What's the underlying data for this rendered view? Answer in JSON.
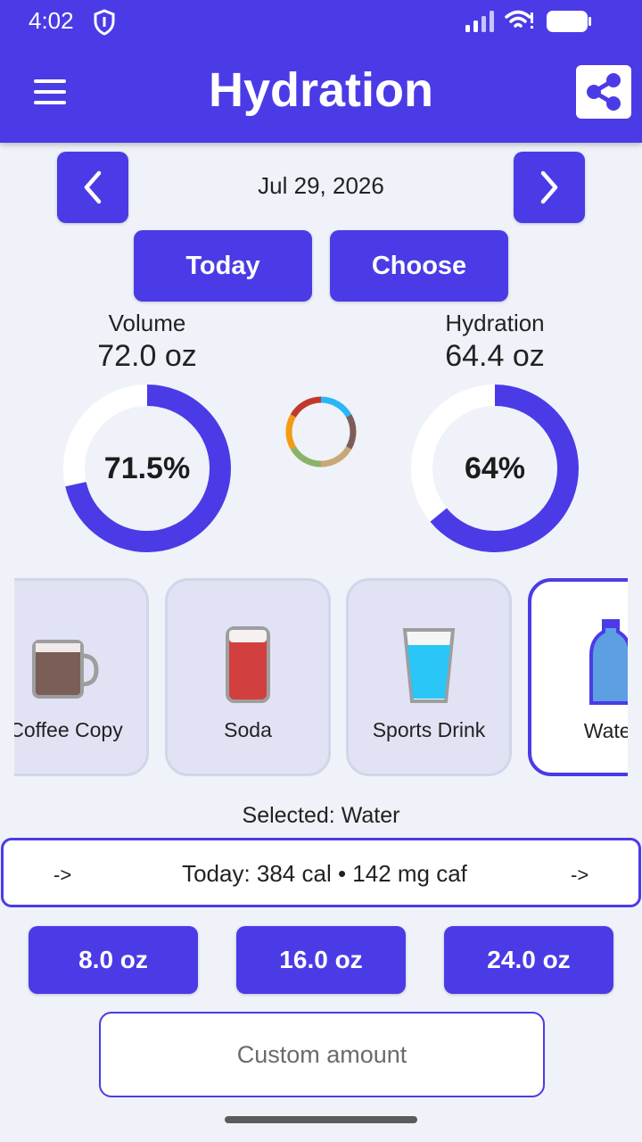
{
  "status_bar": {
    "time": "4:02"
  },
  "header": {
    "title": "Hydration"
  },
  "date_nav": {
    "date": "Jul 29, 2026",
    "today_label": "Today",
    "choose_label": "Choose"
  },
  "volume": {
    "label": "Volume",
    "value": "72.0 oz",
    "percent_label": "71.5%",
    "fraction": 0.715
  },
  "hydration": {
    "label": "Hydration",
    "value": "64.4 oz",
    "percent_label": "64%",
    "fraction": 0.64
  },
  "drinks": [
    {
      "name": "Coffee Copy",
      "icon": "coffee-mug-icon",
      "selected": false
    },
    {
      "name": "Soda",
      "icon": "soda-glass-icon",
      "selected": false
    },
    {
      "name": "Sports Drink",
      "icon": "sports-drink-glass-icon",
      "selected": false
    },
    {
      "name": "Water",
      "icon": "water-bottle-icon",
      "selected": true
    }
  ],
  "selection": {
    "prefix": "Selected:",
    "name": "Water"
  },
  "summary": {
    "left_arrow": "->",
    "text": "Today: 384 cal • 142 mg caf",
    "right_arrow": "->"
  },
  "amounts": [
    "8.0 oz",
    "16.0 oz",
    "24.0 oz"
  ],
  "custom": {
    "placeholder": "Custom amount"
  },
  "colors": {
    "accent": "#4b3be6",
    "background": "#eff2f8",
    "card": "#e1e3f5"
  }
}
